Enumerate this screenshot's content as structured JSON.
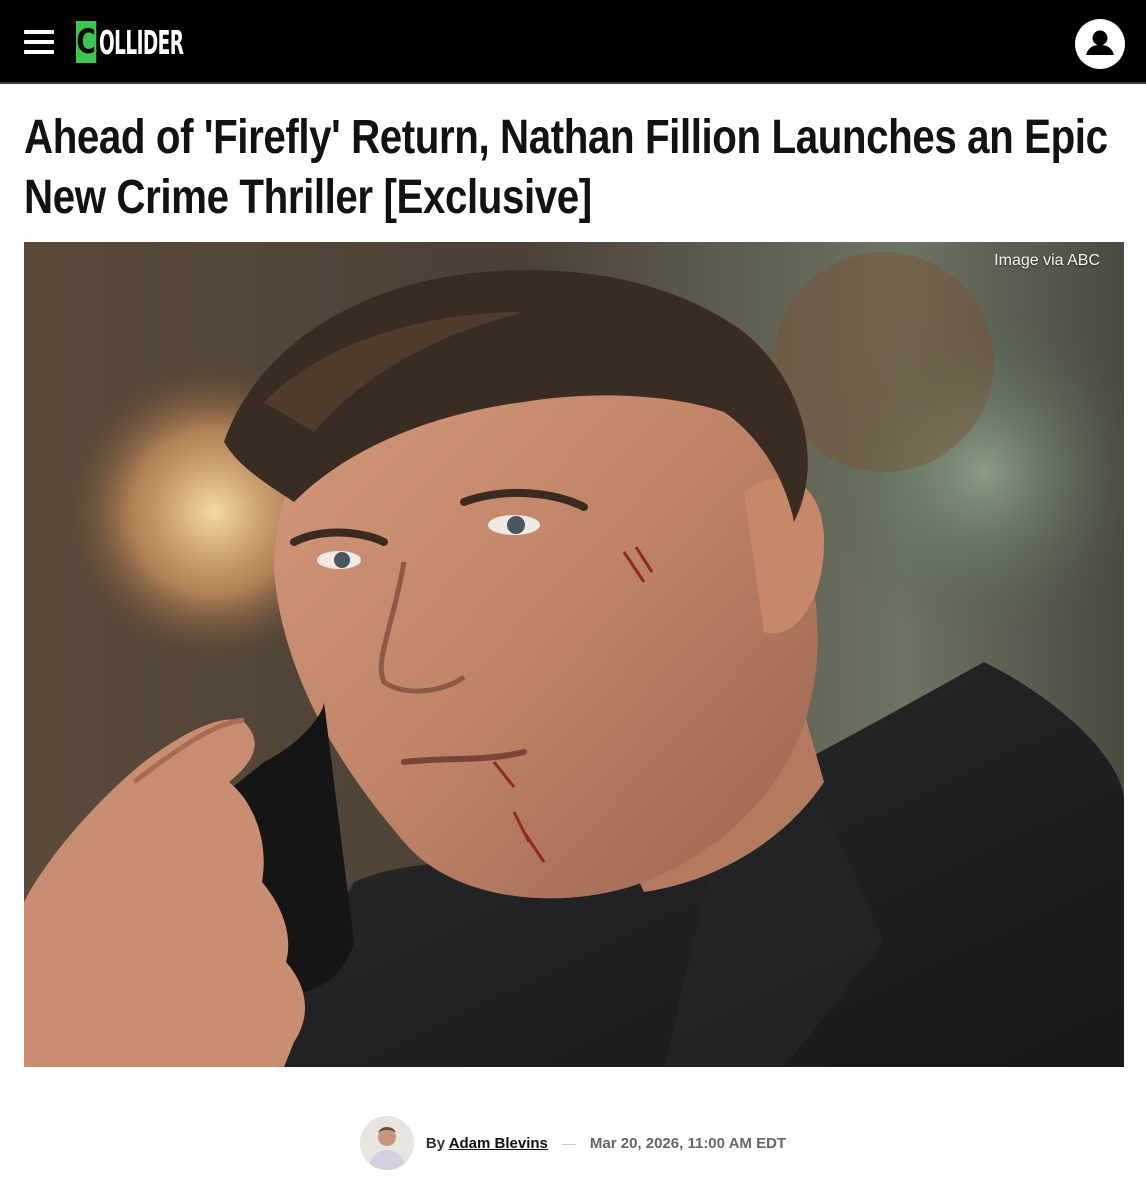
{
  "header": {
    "logo_first_letter": "C",
    "logo_rest": "OLLIDER",
    "menu_icon": "hamburger-menu-icon",
    "user_icon": "user-account-icon",
    "brand_green": "#3dc552",
    "background": "#000000"
  },
  "article": {
    "title": "Ahead of 'Firefly' Return, Nathan Fillion Launches an Epic New Crime Thriller [Exclusive]",
    "image_credit": "Image via ABC"
  },
  "byline": {
    "by_label": "By",
    "author": "Adam Blevins",
    "separator": "—",
    "date": "Mar 20, 2026, 11:00 AM EDT"
  }
}
